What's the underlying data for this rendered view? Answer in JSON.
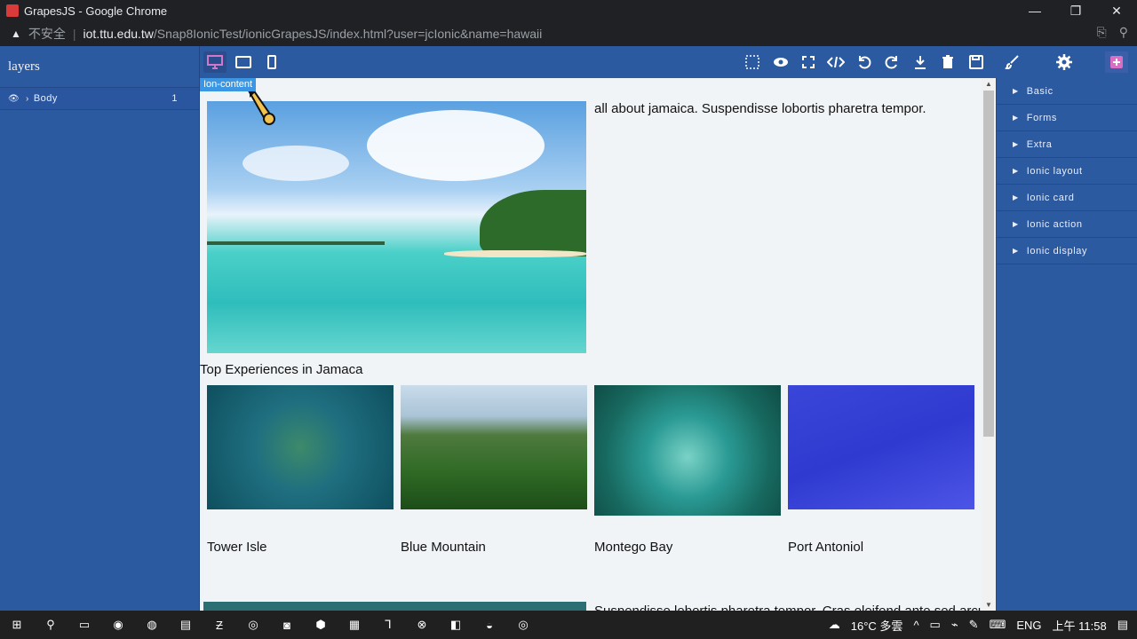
{
  "window": {
    "title": "GrapesJS - Google Chrome",
    "controls": [
      "—",
      "❐",
      "✕"
    ]
  },
  "address": {
    "warning_icon": "warning-icon",
    "insecure_label": "不安全",
    "host": "iot.ttu.edu.tw",
    "path": "/Snap8IonicTest/ionicGrapesJS/index.html?user=jcIonic&name=hawaii"
  },
  "layers": {
    "title": "layers",
    "rows": [
      {
        "label": "Body",
        "count": "1"
      }
    ]
  },
  "toolbar": {
    "devices": [
      "desktop-icon",
      "tablet-icon",
      "mobile-icon"
    ],
    "actions": [
      "select-box-icon",
      "preview-eye-icon",
      "fullscreen-icon",
      "code-icon",
      "undo-icon",
      "redo-icon",
      "download-icon",
      "trash-icon",
      "save-icon"
    ],
    "panels": [
      "brush-icon",
      "gear-icon",
      "plus-icon"
    ]
  },
  "canvas": {
    "badge": "Ion-content",
    "hero_text": "all about jamaica. Suspendisse lobortis pharetra tempor.",
    "section_title": "Top Experiences in Jamaca",
    "cards": [
      {
        "label": "Tower Isle"
      },
      {
        "label": "Blue Mountain"
      },
      {
        "label": "Montego Bay"
      },
      {
        "label": "Port Antoniol"
      }
    ],
    "bottom_text": "Suspendisse lobortis pharetra tempor. Cras eleifend ante sed arcu"
  },
  "blocks": {
    "categories": [
      "Basic",
      "Forms",
      "Extra",
      "Ionic layout",
      "Ionic card",
      "Ionic action",
      "Ionic display"
    ]
  },
  "taskbar": {
    "weather": "16°C 多雲",
    "lang": "ENG",
    "time": "上午 11:58"
  }
}
